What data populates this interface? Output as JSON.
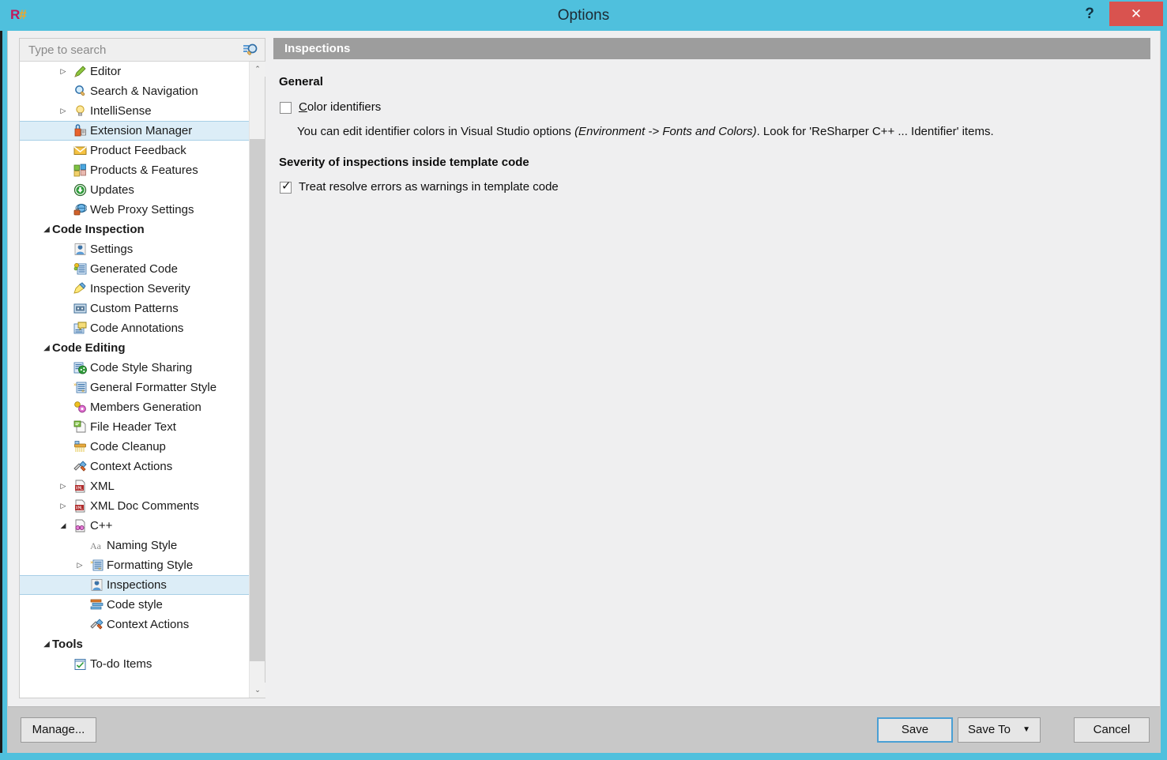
{
  "window": {
    "title": "Options",
    "app_icon": "resharper-icon",
    "help_label": "?",
    "close_label": "✕",
    "accent_color": "#4fc0dd",
    "close_color": "#d9534f"
  },
  "sidebar": {
    "search": {
      "placeholder": "Type to search",
      "value": "",
      "icon": "search-icon"
    },
    "scrollbar": {
      "up_arrow": "⌃",
      "down_arrow": "⌄"
    },
    "items": [
      {
        "label": "Editor",
        "icon": "pencil-icon",
        "level": 1,
        "arrow": "▷",
        "selected": false
      },
      {
        "label": "Search & Navigation",
        "icon": "magnifier-icon",
        "level": 1,
        "arrow": "",
        "selected": false
      },
      {
        "label": "IntelliSense",
        "icon": "lightbulb-icon",
        "level": 1,
        "arrow": "▷",
        "selected": false
      },
      {
        "label": "Extension Manager",
        "icon": "extension-icon",
        "level": 1,
        "arrow": "",
        "selected": true
      },
      {
        "label": "Product Feedback",
        "icon": "envelope-icon",
        "level": 1,
        "arrow": "",
        "selected": false
      },
      {
        "label": "Products & Features",
        "icon": "products-grid-icon",
        "level": 1,
        "arrow": "",
        "selected": false
      },
      {
        "label": "Updates",
        "icon": "download-circle-icon",
        "level": 1,
        "arrow": "",
        "selected": false
      },
      {
        "label": "Web Proxy Settings",
        "icon": "globe-plug-icon",
        "level": 1,
        "arrow": "",
        "selected": false
      },
      {
        "label": "Code Inspection",
        "icon": "",
        "level": 0,
        "arrow": "◢",
        "selected": false,
        "group": true
      },
      {
        "label": "Settings",
        "icon": "person-settings-icon",
        "level": 1,
        "arrow": "",
        "selected": false
      },
      {
        "label": "Generated Code",
        "icon": "generated-code-icon",
        "level": 1,
        "arrow": "",
        "selected": false
      },
      {
        "label": "Inspection Severity",
        "icon": "severity-icon",
        "level": 1,
        "arrow": "",
        "selected": false
      },
      {
        "label": "Custom Patterns",
        "icon": "custom-patterns-icon",
        "level": 1,
        "arrow": "",
        "selected": false
      },
      {
        "label": "Code Annotations",
        "icon": "annotations-icon",
        "level": 1,
        "arrow": "",
        "selected": false
      },
      {
        "label": "Code Editing",
        "icon": "",
        "level": 0,
        "arrow": "◢",
        "selected": false,
        "group": true
      },
      {
        "label": "Code Style Sharing",
        "icon": "share-icon",
        "level": 1,
        "arrow": "",
        "selected": false
      },
      {
        "label": "General Formatter Style",
        "icon": "formatter-icon",
        "level": 1,
        "arrow": "",
        "selected": false
      },
      {
        "label": "Members Generation",
        "icon": "members-gen-icon",
        "level": 1,
        "arrow": "",
        "selected": false
      },
      {
        "label": "File Header Text",
        "icon": "file-header-icon",
        "level": 1,
        "arrow": "",
        "selected": false
      },
      {
        "label": "Code Cleanup",
        "icon": "broom-icon",
        "level": 1,
        "arrow": "",
        "selected": false
      },
      {
        "label": "Context Actions",
        "icon": "hammer-icon",
        "level": 1,
        "arrow": "",
        "selected": false
      },
      {
        "label": "XML",
        "icon": "xml-file-icon",
        "level": 1,
        "arrow": "▷",
        "selected": false
      },
      {
        "label": "XML Doc Comments",
        "icon": "xml-file-icon",
        "level": 1,
        "arrow": "▷",
        "selected": false
      },
      {
        "label": "C++",
        "icon": "cpp-file-icon",
        "level": 1,
        "arrow": "◢",
        "selected": false
      },
      {
        "label": "Naming Style",
        "icon": "naming-style-icon",
        "level": 2,
        "arrow": "",
        "selected": false
      },
      {
        "label": "Formatting Style",
        "icon": "formatter-icon",
        "level": 2,
        "arrow": "▷",
        "selected": false
      },
      {
        "label": "Inspections",
        "icon": "person-settings-icon",
        "level": 2,
        "arrow": "",
        "selected": true
      },
      {
        "label": "Code style",
        "icon": "code-style-icon",
        "level": 2,
        "arrow": "",
        "selected": false
      },
      {
        "label": "Context Actions",
        "icon": "hammer-icon",
        "level": 2,
        "arrow": "",
        "selected": false
      },
      {
        "label": "Tools",
        "icon": "",
        "level": 0,
        "arrow": "◢",
        "selected": false,
        "group": true
      },
      {
        "label": "To-do Items",
        "icon": "todo-icon",
        "level": 1,
        "arrow": "",
        "selected": false
      }
    ]
  },
  "page": {
    "header": "Inspections",
    "sections": {
      "general_title": "General",
      "severity_title": "Severity of inspections inside template code"
    },
    "color_identifiers": {
      "label_accel": "C",
      "label_rest": "olor identifiers",
      "checked": false
    },
    "description": {
      "part1": "You can edit identifier colors in Visual Studio options ",
      "italic": "(Environment -> Fonts and Colors)",
      "part2": ". Look for 'ReSharper C++ ... Identifier' items."
    },
    "treat_resolve": {
      "label": "Treat resolve errors as warnings in template code",
      "checked": true,
      "tick": "✓"
    }
  },
  "footer": {
    "manage_label": "Manage...",
    "save_label": "Save",
    "save_to_label": "Save To",
    "save_to_carat": "▼",
    "cancel_label": "Cancel"
  }
}
